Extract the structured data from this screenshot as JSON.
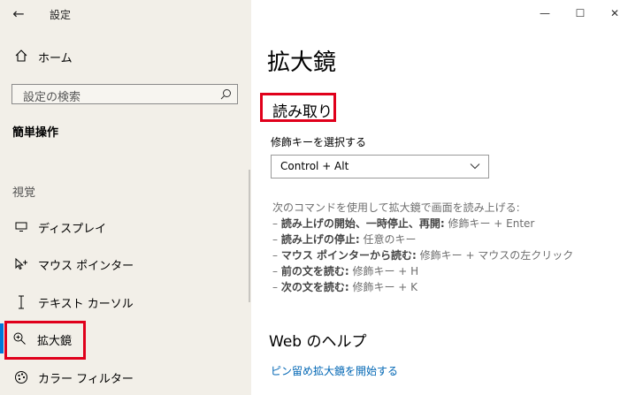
{
  "window": {
    "title": "設定",
    "back_label": "←",
    "minimize": "—",
    "maximize": "☐",
    "close": "✕"
  },
  "sidebar": {
    "home": "ホーム",
    "search": {
      "placeholder": "設定の検索"
    },
    "section_title": "簡単操作",
    "category": "視覚",
    "items": [
      {
        "label": "ディスプレイ",
        "icon": "display-icon"
      },
      {
        "label": "マウス ポインター",
        "icon": "mouse-pointer-icon"
      },
      {
        "label": "テキスト カーソル",
        "icon": "text-cursor-icon"
      },
      {
        "label": "拡大鏡",
        "icon": "magnifier-icon",
        "selected": true
      },
      {
        "label": "カラー フィルター",
        "icon": "color-filter-icon"
      }
    ]
  },
  "main": {
    "page_title": "拡大鏡",
    "section_title": "読み取り",
    "modifier_label": "修飾キーを選択する",
    "modifier_value": "Control + Alt",
    "commands_intro": "次のコマンドを使用して拡大鏡で画面を読み上げる:",
    "commands": [
      {
        "bold": "読み上げの開始、一時停止、再開:",
        "rest": " 修飾キー + Enter"
      },
      {
        "bold": "読み上げの停止:",
        "rest": " 任意のキー"
      },
      {
        "bold": "マウス ポインターから読む:",
        "rest": " 修飾キー + マウスの左クリック"
      },
      {
        "bold": "前の文を読む:",
        "rest": " 修飾キー + H"
      },
      {
        "bold": "次の文を読む:",
        "rest": " 修飾キー + K"
      }
    ],
    "web_title": "Web のヘルプ",
    "link": "ピン留め拡大鏡を開始する"
  },
  "colors": {
    "accent": "#0078d7",
    "highlight": "#e0001b",
    "link": "#0066b4",
    "sidebar_bg": "#f2efe8"
  }
}
